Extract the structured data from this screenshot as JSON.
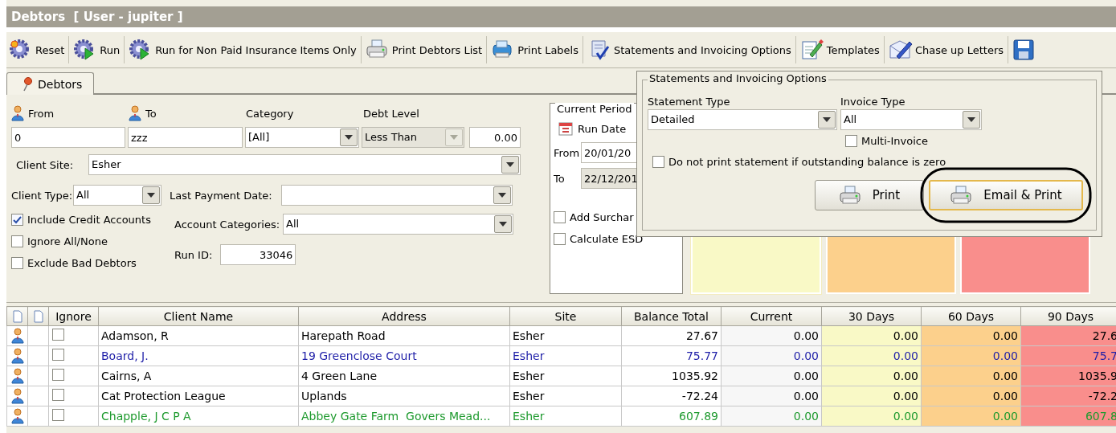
{
  "window": {
    "title": "Debtors  [ User - jupiter ]"
  },
  "toolbar": [
    {
      "kind": "gear",
      "label": "Reset"
    },
    {
      "kind": "run",
      "label": "Run"
    },
    {
      "kind": "run",
      "label": "Run for Non Paid Insurance Items Only"
    },
    {
      "kind": "printer",
      "label": "Print Debtors List"
    },
    {
      "kind": "labels",
      "label": "Print Labels"
    },
    {
      "kind": "statement",
      "label": "Statements and Invoicing Options"
    },
    {
      "kind": "template",
      "label": "Templates"
    },
    {
      "kind": "letter",
      "label": "Chase up Letters"
    },
    {
      "kind": "save"
    }
  ],
  "tabs": [
    {
      "label": "Debtors",
      "selected": true
    }
  ],
  "filters": {
    "from": {
      "label": "From",
      "value": "0"
    },
    "to": {
      "label": "To",
      "value": "zzz"
    },
    "category": {
      "label": "Category",
      "value": "[All]"
    },
    "debt_level": {
      "label": "Debt Level",
      "value": "Less Than",
      "disabled": true,
      "amount": "0.00"
    },
    "client_site": {
      "label": "Client Site:",
      "value": "Esher"
    },
    "client_type": {
      "label": "Client Type:",
      "value": "All"
    },
    "last_payment_date": {
      "label": "Last Payment Date:"
    },
    "account_categories": {
      "label": "Account Categories:",
      "value": "All"
    },
    "run_id": {
      "label": "Run ID:",
      "value": "33046"
    },
    "checkboxes": [
      {
        "label": "Include Credit Accounts",
        "checked": true
      },
      {
        "label": "Ignore All/None",
        "checked": false
      },
      {
        "label": "Exclude Bad Debtors",
        "checked": false
      }
    ]
  },
  "current_period": {
    "title": "Current Period",
    "run_date": "Run Date",
    "from_label": "From",
    "from_value": "20/01/20",
    "to_label": "To",
    "to_value": "22/12/201",
    "checkboxes": [
      {
        "label": "Add Surchar",
        "checked": false
      },
      {
        "label": "Calculate ESD",
        "checked": false
      }
    ]
  },
  "statements_popup": {
    "title": "Statements and Invoicing Options",
    "statement_type": {
      "label": "Statement Type",
      "value": "Detailed"
    },
    "invoice_type": {
      "label": "Invoice Type",
      "value": "All"
    },
    "multi_invoice": {
      "label": "Multi-Invoice",
      "checked": false
    },
    "zero_balance": {
      "label": "Do not print statement if outstanding balance is zero",
      "checked": false
    },
    "buttons": [
      {
        "label": "Print",
        "focused": false,
        "circled": false
      },
      {
        "label": "Email & Print",
        "focused": true,
        "circled": true
      }
    ]
  },
  "table": {
    "columns": [
      "Ignore",
      "Client Name",
      "Address",
      "Site",
      "Balance Total",
      "Current",
      "30 Days",
      "60 Days",
      "90 Days"
    ],
    "rows": [
      {
        "ignore": false,
        "color": "#000000",
        "cells": [
          "",
          "Adamson, R",
          "Harepath Road",
          "Esher",
          "27.67",
          "0.00",
          "0.00",
          "0.00",
          "27.6"
        ]
      },
      {
        "ignore": false,
        "color": "#1f1fa8",
        "cells": [
          "",
          "Board, J.",
          "19 Greenclose Court",
          "Esher",
          "75.77",
          "0.00",
          "0.00",
          "0.00",
          "75.7"
        ]
      },
      {
        "ignore": false,
        "color": "#000000",
        "cells": [
          "",
          "Cairns, A",
          "4 Green Lane",
          "Esher",
          "1035.92",
          "0.00",
          "0.00",
          "0.00",
          "1035.9"
        ]
      },
      {
        "ignore": false,
        "color": "#000000",
        "cells": [
          "",
          "Cat Protection League",
          "Uplands",
          "Esher",
          "-72.24",
          "0.00",
          "0.00",
          "0.00",
          "-72.2"
        ]
      },
      {
        "ignore": false,
        "color": "#1e9a2e",
        "cells": [
          "",
          "Chapple, J C P A",
          "Abbey Gate Farm  Govers Mead...",
          "Esher",
          "607.89",
          "0.00",
          "0.00",
          "0.00",
          "607.8"
        ]
      }
    ]
  }
}
